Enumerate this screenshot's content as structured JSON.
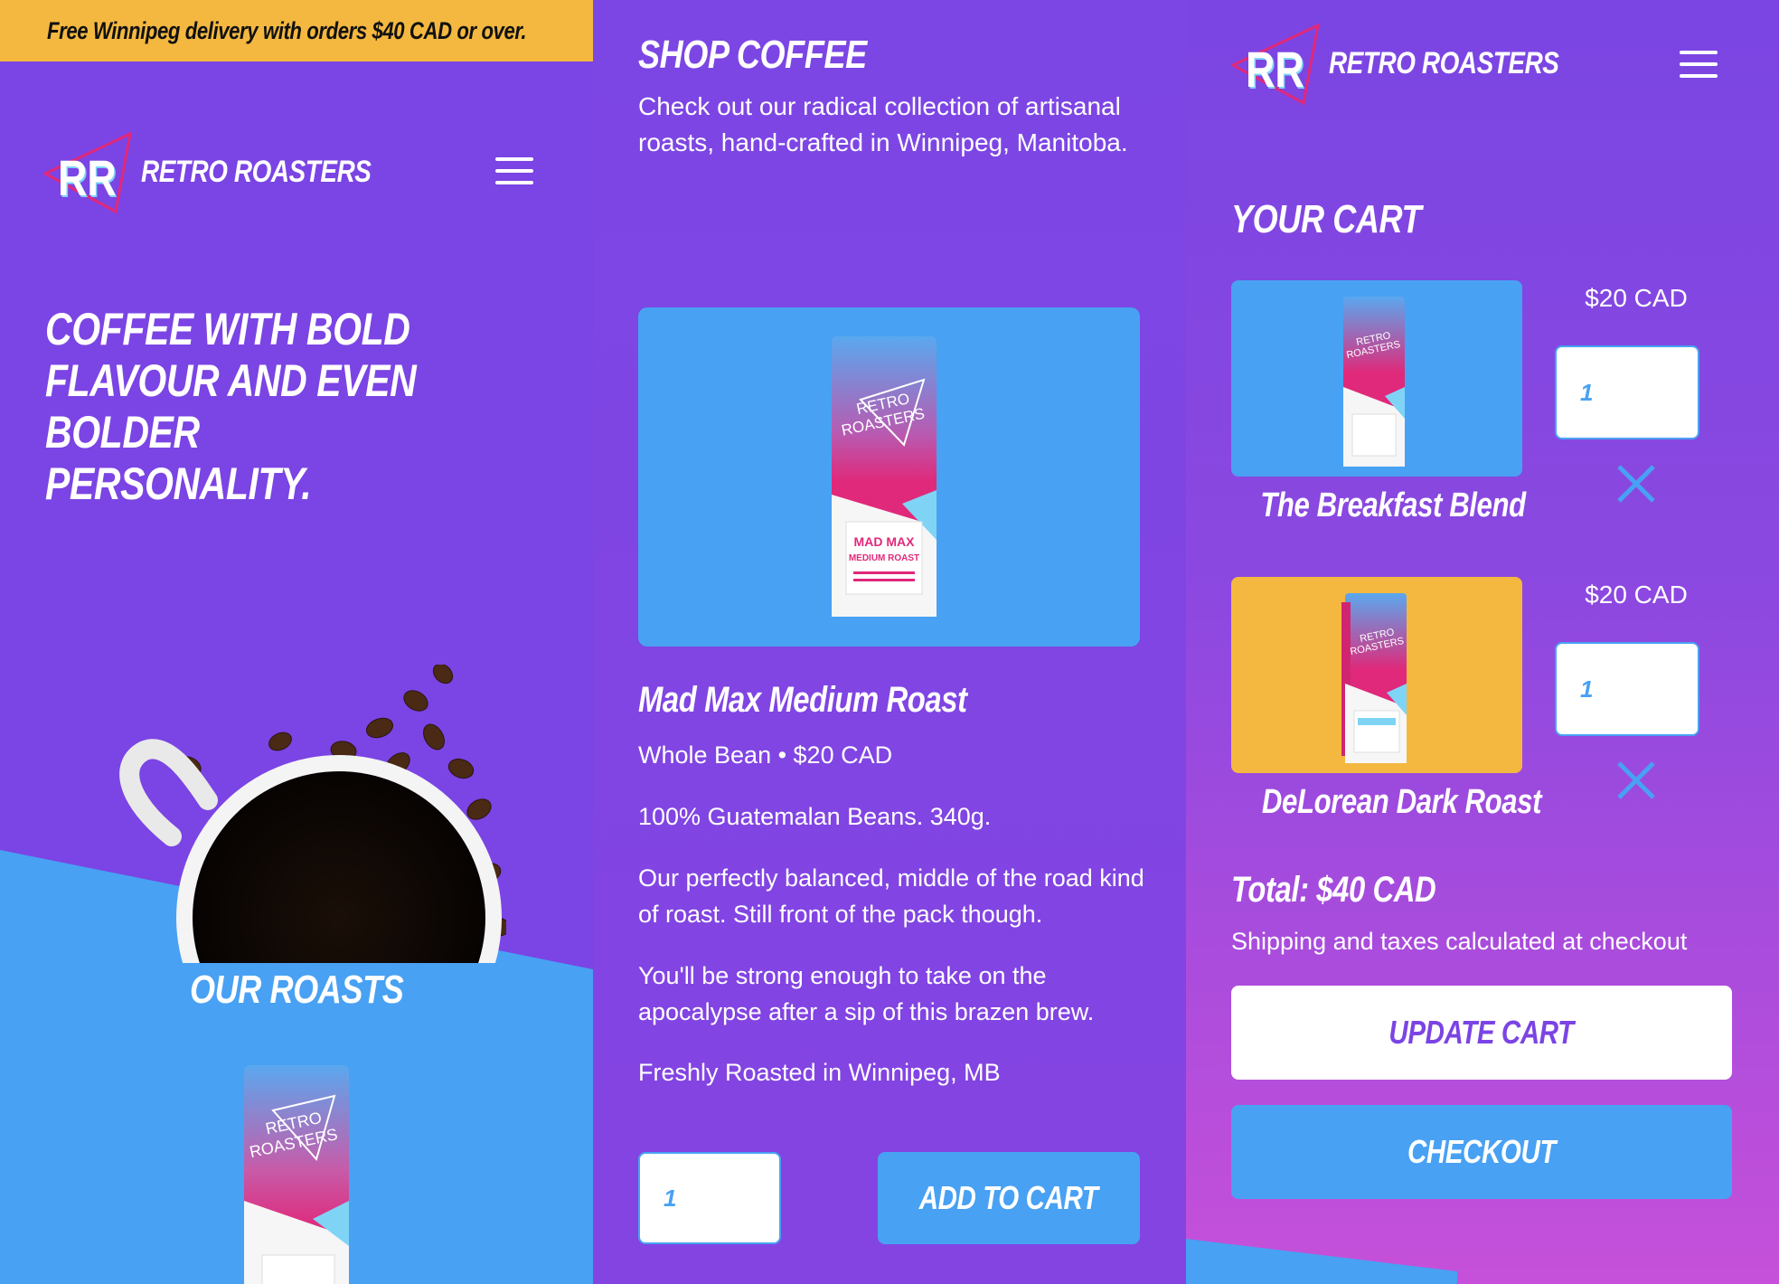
{
  "colors": {
    "purple": "#7b44e4",
    "blue": "#48a1f3",
    "yellow": "#f4b840",
    "pink": "#e0297a",
    "white": "#ffffff"
  },
  "home": {
    "promo_banner": "Free Winnipeg delivery with orders $40 CAD or over.",
    "brand": "RETRO ROASTERS",
    "logo_monogram": "RR",
    "menu_icon": "hamburger-menu-icon",
    "hero_lines": [
      "COFFEE WITH BOLD",
      "FLAVOUR AND EVEN",
      "BOLDER",
      "PERSONALITY."
    ],
    "section_heading": "OUR ROASTS"
  },
  "shop": {
    "title": "SHOP COFFEE",
    "description": "Check out our radical collection of artisanal roasts, hand-crafted in Winnipeg, Manitoba.",
    "product": {
      "bag_brand": "RETRO ROASTERS",
      "bag_label": "MAD MAX MEDIUM ROAST",
      "name": "Mad Max Medium Roast",
      "meta": "Whole Bean • $20 CAD",
      "origin": "100% Guatemalan Beans. 340g.",
      "blurb1": "Our perfectly balanced, middle of the road kind of roast. Still front of the pack though.",
      "blurb2": "You'll be strong enough to take on the apocalypse after a sip of this brazen brew.",
      "roasted": "Freshly Roasted in Winnipeg, MB",
      "quantity": "1",
      "add_to_cart_label": "ADD TO CART"
    }
  },
  "cart": {
    "brand": "RETRO ROASTERS",
    "title": "YOUR CART",
    "items": [
      {
        "name": "The Breakfast Blend",
        "price": "$20 CAD",
        "quantity": "1",
        "bg": "#48a1f3"
      },
      {
        "name": "DeLorean Dark Roast",
        "price": "$20 CAD",
        "quantity": "1",
        "bg": "#f4b840"
      }
    ],
    "total": "Total: $40 CAD",
    "shipping_note": "Shipping and taxes calculated at checkout",
    "update_label": "UPDATE CART",
    "checkout_label": "CHECKOUT",
    "remove_icon": "close-x-icon"
  }
}
